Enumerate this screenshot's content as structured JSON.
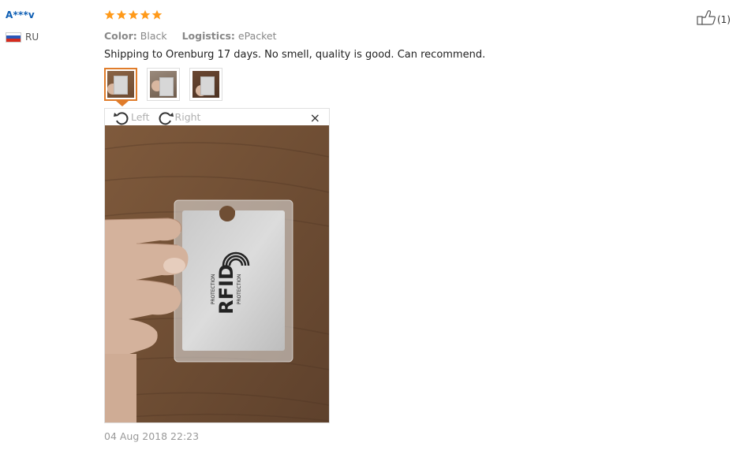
{
  "reviewer": {
    "name": "A***v",
    "country_code": "RU",
    "flag_colors": [
      "#ffffff",
      "#2b57b8",
      "#d52b1e"
    ]
  },
  "review": {
    "rating": 5,
    "star_color": "#ff9a1a",
    "color_label": "Color:",
    "color_value": "Black",
    "logistics_label": "Logistics:",
    "logistics_value": "ePacket",
    "text": "Shipping to Orenburg 17 days. No smell, quality is good. Can recommend.",
    "thumbnails": 3,
    "active_thumbnail": 0,
    "date": "04 Aug 2018 22:23"
  },
  "viewer": {
    "rotate_left_label": "Left",
    "rotate_right_label": "Right",
    "close_label": "×",
    "photo_text_main": "RFID",
    "photo_text_sub": "PROTECTION",
    "photo_text_sub2": "PROTECTION"
  },
  "helpful": {
    "count": "(1)",
    "icon": "thumbs-up-icon"
  },
  "colors": {
    "accent": "#e07c2a",
    "name_blue": "#0f5fb4"
  }
}
